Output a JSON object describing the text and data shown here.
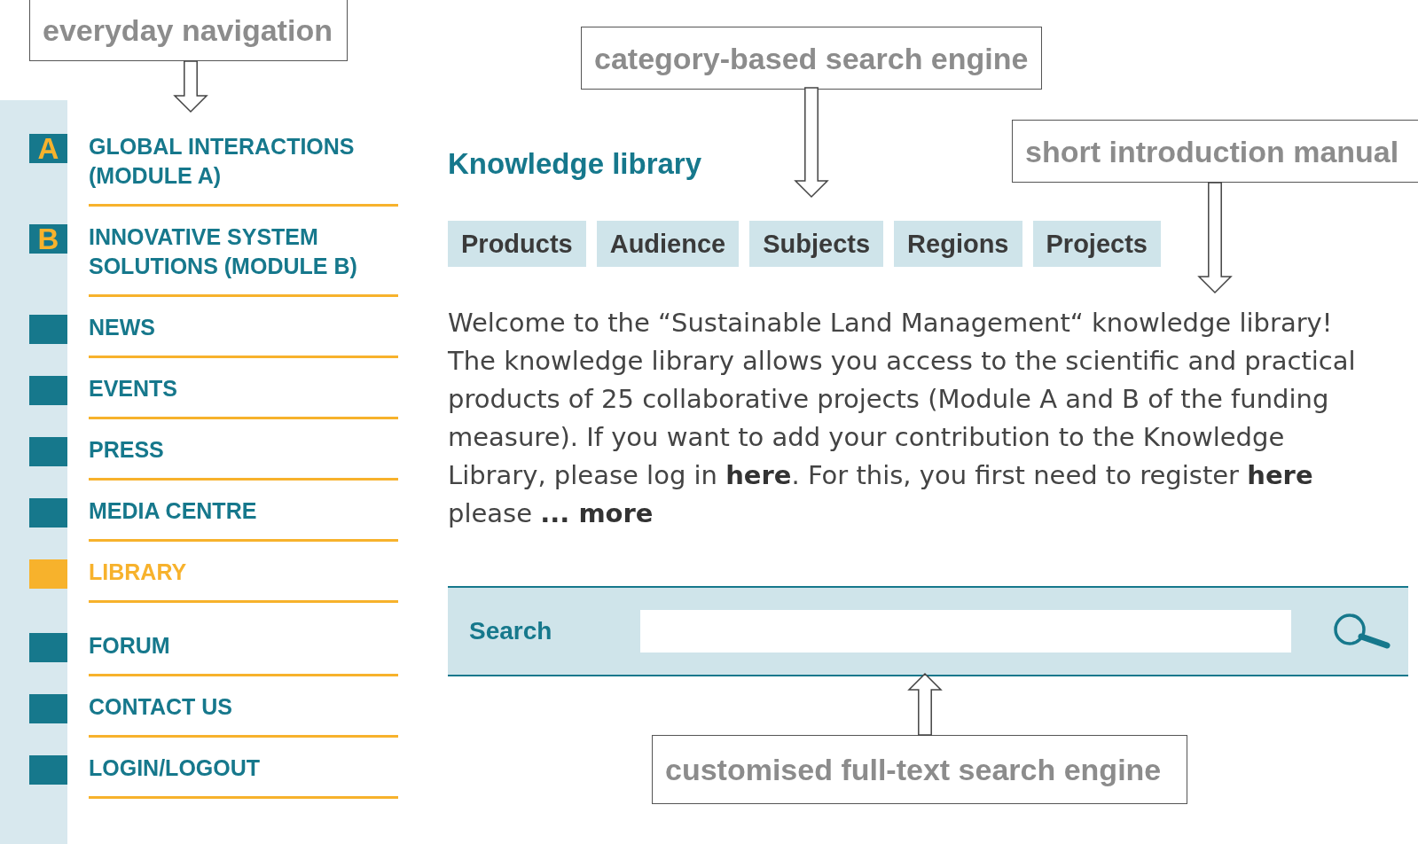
{
  "navigation": {
    "items": [
      {
        "kind": "letter",
        "badge": "A",
        "label": "GLOBAL INTERACTIONS (MODULE A)",
        "selected": false
      },
      {
        "kind": "letter",
        "badge": "B",
        "label": "INNOVATIVE SYSTEM SOLUTIONS (MODULE B)",
        "selected": false
      },
      {
        "kind": "plain",
        "label": "NEWS",
        "selected": false
      },
      {
        "kind": "plain",
        "label": "EVENTS",
        "selected": false
      },
      {
        "kind": "plain",
        "label": "PRESS",
        "selected": false
      },
      {
        "kind": "plain",
        "label": "MEDIA CENTRE",
        "selected": false
      },
      {
        "kind": "plain",
        "label": "LIBRARY",
        "selected": true
      },
      {
        "kind": "plain",
        "label": "FORUM",
        "selected": false
      },
      {
        "kind": "plain",
        "label": "CONTACT US",
        "selected": false
      },
      {
        "kind": "plain",
        "label": "LOGIN/LOGOUT",
        "selected": false
      }
    ]
  },
  "main": {
    "title": "Knowledge library",
    "tabs": [
      "Products",
      "Audience",
      "Subjects",
      "Regions",
      "Projects"
    ],
    "intro": [
      "Welcome to the “Sustainable Land Management“ knowledge library!",
      "The knowledge library allows you access to the scientific and practical products of 25 collaborative projects (Module A and B of the funding measure). If you want to add your contribution to the Knowledge Library, please log in **here**. For this, you first need to register **here** please **... more**"
    ],
    "search": {
      "label": "Search"
    }
  },
  "annotations": [
    {
      "kind": "down",
      "text": "everyday navigation"
    },
    {
      "kind": "down",
      "text": "category-based search engine"
    },
    {
      "kind": "down",
      "text": "short introduction manual"
    },
    {
      "kind": "up",
      "text": "customised full-text search engine"
    }
  ]
}
